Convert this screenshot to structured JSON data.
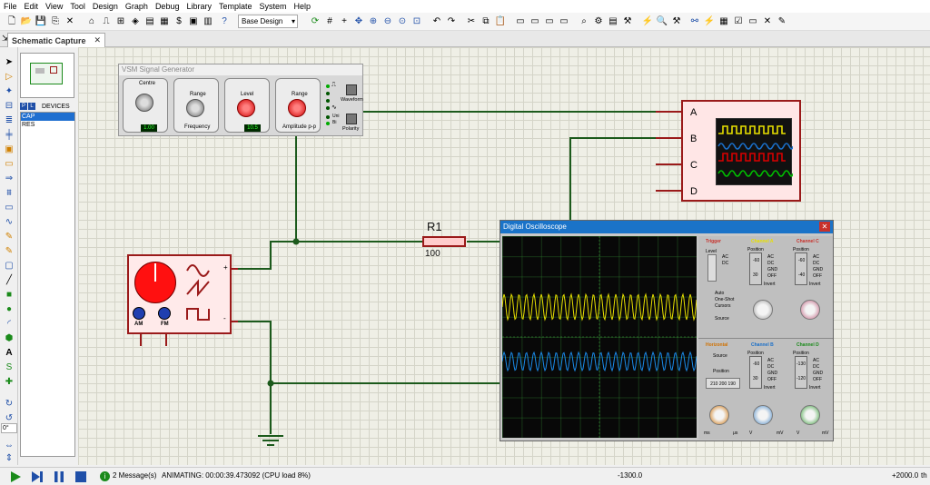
{
  "menu": [
    "File",
    "Edit",
    "View",
    "Tool",
    "Design",
    "Graph",
    "Debug",
    "Library",
    "Template",
    "System",
    "Help"
  ],
  "toolbar": {
    "design_select": "Base Design"
  },
  "tabs": [
    {
      "label": "Schematic Capture"
    }
  ],
  "devices": {
    "header": "DEVICES",
    "p_label": "P",
    "l_label": "L",
    "items": [
      "CAP",
      "RES"
    ]
  },
  "left_tools": {
    "angle_value": "0°"
  },
  "sig_gen": {
    "title": "VSM Signal Generator",
    "centre_label": "Centre",
    "centre_display": "1.00",
    "range_label": "Range",
    "frequency_label": "Frequency",
    "level_label": "Level",
    "level_display": "10.5",
    "range2_label": "Range",
    "amplitude_label": "Amplitude p-p",
    "waveform_label": "Waveform",
    "polarity_label": "Polarity",
    "uni_label": "Uni",
    "bi_label": "Bi"
  },
  "resistor": {
    "ref": "R1",
    "value": "100"
  },
  "source": {
    "am": "AM",
    "fm": "FM",
    "plus": "+",
    "minus": "-"
  },
  "scope_ports": [
    "A",
    "B",
    "C",
    "D"
  ],
  "dso": {
    "title": "Digital Oscilloscope",
    "trigger": "Trigger",
    "channel_a": "Channel A",
    "channel_b": "Channel B",
    "channel_c": "Channel C",
    "channel_d": "Channel D",
    "horizontal": "Horizontal",
    "level": "Level",
    "ac": "AC",
    "dc": "DC",
    "gnd": "GND",
    "off": "OFF",
    "invert": "Invert",
    "auto": "Auto",
    "one_shot": "One-Shot",
    "cursors": "Cursors",
    "source": "Source",
    "position": "Position",
    "ch_b_vals": [
      "-60",
      "30"
    ],
    "ch_c_vals": [
      "-60",
      "-40"
    ],
    "ch_b2_vals": [
      "-60",
      "30"
    ],
    "ch_d_vals": [
      "-130",
      "-120"
    ],
    "horiz_pos": "210 200 190",
    "mv": "mV",
    "v": "V",
    "ms": "ms",
    "us": "μs"
  },
  "status": {
    "messages": "2 Message(s)",
    "animating": "ANIMATING: 00:00:39.473092 (CPU load 8%)",
    "coord_x": "-1300.0",
    "coord_y": "+2000.0",
    "unit": "th"
  },
  "colors": {
    "wire": "#1c5a1c",
    "component_border": "#9a1a1a",
    "trace_a": "#e8e000",
    "trace_b": "#1a6fc8",
    "trace_c": "#d80000",
    "trace_d": "#00c000"
  }
}
